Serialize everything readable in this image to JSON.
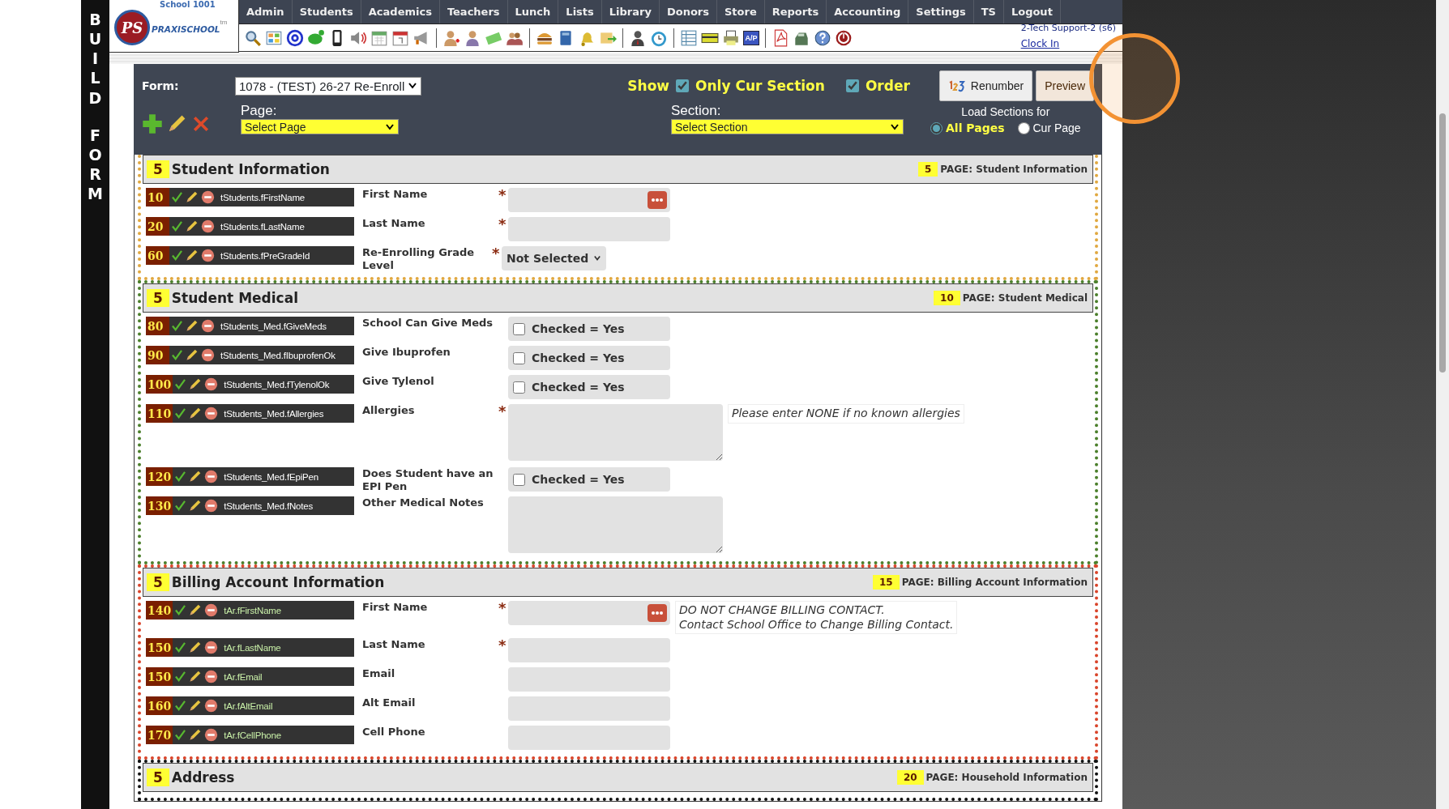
{
  "side_label": [
    "BUILD",
    "FORM"
  ],
  "logo": {
    "school": "School 1001",
    "monogram": "PS",
    "name": "PRAXISCHOOL",
    "tm": "tm"
  },
  "menu": [
    "Admin",
    "Students",
    "Academics",
    "Teachers",
    "Lunch",
    "Lists",
    "Library",
    "Donors",
    "Store",
    "Reports",
    "Accounting",
    "Settings",
    "TS",
    "Logout"
  ],
  "toolbar_badge": "A/P",
  "user": {
    "name": "2-Tech Support-2 (s6)",
    "link": "Clock In"
  },
  "form": {
    "form_label": "Form:",
    "form_value": "1078 - (TEST) 26-27 Re-Enroll",
    "show_label": "Show",
    "options": [
      {
        "label": "Only Cur Section",
        "checked": true
      },
      {
        "label": "Order",
        "checked": true
      }
    ],
    "buttons": [
      {
        "label": "Renumber",
        "kind": "renumber",
        "highlighted": false
      },
      {
        "label": "Preview",
        "kind": "preview",
        "highlighted": true
      }
    ],
    "page_label": "Page:",
    "page_select": "Select Page",
    "section_label": "Section:",
    "section_select": "Select Section",
    "load_label": "Load Sections for",
    "load_options": [
      {
        "label": "All Pages",
        "selected": true
      },
      {
        "label": "Cur Page",
        "selected": false
      }
    ]
  },
  "sections": [
    {
      "number": "5",
      "title": "Student Information",
      "page_number": "5",
      "page_title": "PAGE: Student Information",
      "color": "#e0a840",
      "rows": [
        {
          "order": "10",
          "field": "tStudents.fFirstName",
          "color": "#ffffff",
          "label": "First Name",
          "mark": "*",
          "kind": "text",
          "more": true
        },
        {
          "order": "20",
          "field": "tStudents.fLastName",
          "color": "#ffffff",
          "label": "Last Name",
          "mark": "*",
          "kind": "text",
          "more": false
        },
        {
          "order": "60",
          "field": "tStudents.fPreGradeId",
          "color": "#ffffff",
          "label": "Re-Enrolling Grade Level",
          "mark": "*",
          "kind": "select",
          "value": "Not Selected"
        }
      ]
    },
    {
      "number": "5",
      "title": "Student Medical",
      "page_number": "10",
      "page_title": "PAGE: Student Medical",
      "color": "#4b7f2b",
      "rows": [
        {
          "order": "80",
          "field": "tStudents_Med.fGiveMeds",
          "color": "#ffffff",
          "label": "School Can Give Meds",
          "kind": "checkbox",
          "check_label": "Checked = Yes",
          "checked": false
        },
        {
          "order": "90",
          "field": "tStudents_Med.fIbuprofenOk",
          "color": "#ffffff",
          "label": "Give Ibuprofen",
          "kind": "checkbox",
          "check_label": "Checked = Yes",
          "checked": false
        },
        {
          "order": "100",
          "field": "tStudents_Med.fTylenolOk",
          "color": "#ffffff",
          "label": "Give Tylenol",
          "kind": "checkbox",
          "check_label": "Checked = Yes",
          "checked": false
        },
        {
          "order": "110",
          "field": "tStudents_Med.fAllergies",
          "color": "#ffffff",
          "label": "Allergies",
          "mark": "*",
          "kind": "textarea",
          "note": "Please enter NONE if no known allergies"
        },
        {
          "order": "120",
          "field": "tStudents_Med.fEpiPen",
          "color": "#ffffff",
          "label": "Does Student have an EPI Pen",
          "kind": "checkbox",
          "check_label": "Checked = Yes",
          "checked": false
        },
        {
          "order": "130",
          "field": "tStudents_Med.fNotes",
          "color": "#ffffff",
          "label": "Other Medical Notes",
          "kind": "textarea"
        }
      ]
    },
    {
      "number": "5",
      "title": "Billing Account Information",
      "page_number": "15",
      "page_title": "PAGE: Billing Account Information",
      "color": "#d9442a",
      "rows": [
        {
          "order": "140",
          "field": "tAr.fFirstName",
          "color": "#c9f0a8",
          "label": "First Name",
          "mark": "*",
          "kind": "text",
          "more": true,
          "note": "DO NOT CHANGE BILLING CONTACT.\nContact School Office to Change Billing Contact."
        },
        {
          "order": "150",
          "field": "tAr.fLastName",
          "color": "#c9f0a8",
          "label": "Last Name",
          "mark": "*",
          "kind": "text",
          "more": false
        },
        {
          "order": "150",
          "field": "tAr.fEmail",
          "color": "#c9f0a8",
          "label": "Email",
          "kind": "text",
          "more": false
        },
        {
          "order": "160",
          "field": "tAr.fAltEmail",
          "color": "#c9f0a8",
          "label": "Alt Email",
          "kind": "text",
          "more": false
        },
        {
          "order": "170",
          "field": "tAr.fCellPhone",
          "color": "#c9f0a8",
          "label": "Cell Phone",
          "kind": "text",
          "more": false
        }
      ]
    },
    {
      "number": "5",
      "title": "Address",
      "page_number": "20",
      "page_title": "PAGE: Household Information",
      "color": "#111111"
    }
  ]
}
